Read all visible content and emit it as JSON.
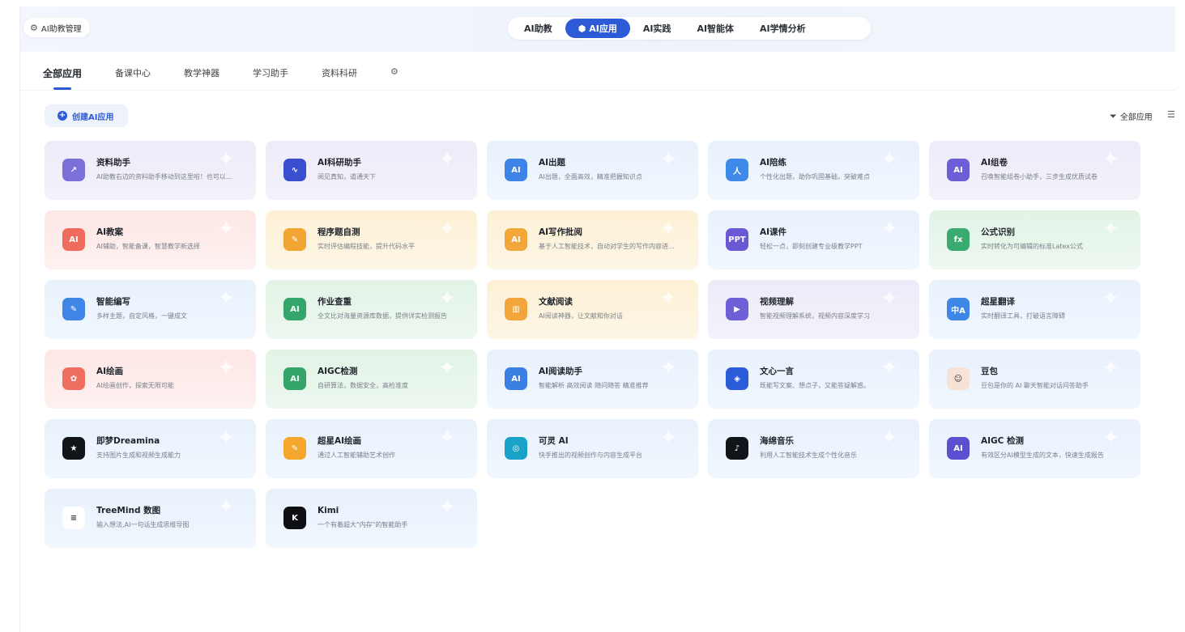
{
  "header": {
    "manage_label": "AI助教管理",
    "nav": [
      {
        "label": "AI助教",
        "active": false
      },
      {
        "label": "AI应用",
        "active": true
      },
      {
        "label": "AI实践",
        "active": false
      },
      {
        "label": "AI智能体",
        "active": false
      },
      {
        "label": "AI学情分析",
        "active": false
      }
    ]
  },
  "subtabs": [
    "全部应用",
    "备课中心",
    "教学神器",
    "学习助手",
    "资料科研"
  ],
  "toolbar": {
    "create_label": "创建AI应用",
    "filter_label": "全部应用"
  },
  "colors": {
    "accent": "#2d5bd7"
  },
  "apps": [
    {
      "title": "资料助手",
      "desc": "AI助教右边的资料助手移动到这里啦！也可以...",
      "theme": "purple",
      "icon": "chart-icon",
      "icon_bg": "#7b6fd8",
      "glyph": "↗"
    },
    {
      "title": "AI科研助手",
      "desc": "阅见真知，道通天下",
      "theme": "purple",
      "icon": "research-icon",
      "icon_bg": "#3a4fd0",
      "glyph": "∿"
    },
    {
      "title": "AI出题",
      "desc": "AI出题，全面高效，精准把握知识点",
      "theme": "blue",
      "icon": "question-icon",
      "icon_bg": "#3e84e6",
      "glyph": "AI"
    },
    {
      "title": "AI陪练",
      "desc": "个性化出题，助你巩固基础，突破难点",
      "theme": "blue",
      "icon": "practice-icon",
      "icon_bg": "#3f8ae8",
      "glyph": "人"
    },
    {
      "title": "AI组卷",
      "desc": "召唤智能组卷小助手，三步生成优质试卷",
      "theme": "purple",
      "icon": "layers-icon",
      "icon_bg": "#6c5ed6",
      "glyph": "AI"
    },
    {
      "title": "AI教案",
      "desc": "AI辅助，智能备课，智慧教学新选择",
      "theme": "pink",
      "icon": "lesson-plan-icon",
      "icon_bg": "#ef6b5d",
      "glyph": "AI"
    },
    {
      "title": "程序题自测",
      "desc": "实时评估编程技能，提升代码水平",
      "theme": "yellow",
      "icon": "code-icon",
      "icon_bg": "#f2a532",
      "glyph": "✎"
    },
    {
      "title": "AI写作批阅",
      "desc": "基于人工智能技术，自动对学生的写作内容进...",
      "theme": "yellow",
      "icon": "writing-review-icon",
      "icon_bg": "#f3a63a",
      "glyph": "AI"
    },
    {
      "title": "AI课件",
      "desc": "轻松一点，即刻创建专业级教学PPT",
      "theme": "blue",
      "icon": "ppt-icon",
      "icon_bg": "#6b58d4",
      "glyph": "PPT"
    },
    {
      "title": "公式识别",
      "desc": "实时转化为可编辑的标准Latex公式",
      "theme": "green",
      "icon": "formula-icon",
      "icon_bg": "#3aaa6e",
      "glyph": "fx"
    },
    {
      "title": "智能编写",
      "desc": "多样主题，自定风格，一键成文",
      "theme": "blue",
      "icon": "edit-icon",
      "icon_bg": "#3f86e6",
      "glyph": "✎"
    },
    {
      "title": "作业查重",
      "desc": "全文比对海量资源库数据，提供详实检测报告",
      "theme": "green",
      "icon": "duplicate-check-icon",
      "icon_bg": "#34a66c",
      "glyph": "AI"
    },
    {
      "title": "文献阅读",
      "desc": "AI阅读神器，让文献和你对话",
      "theme": "yellow",
      "icon": "book-icon",
      "icon_bg": "#f2a53a",
      "glyph": "▥"
    },
    {
      "title": "视频理解",
      "desc": "智能视频理解系统，视频内容深度学习",
      "theme": "purple",
      "icon": "video-icon",
      "icon_bg": "#6d5fd6",
      "glyph": "▶"
    },
    {
      "title": "超星翻译",
      "desc": "实时翻译工具，打破语言障碍",
      "theme": "blue",
      "icon": "translate-icon",
      "icon_bg": "#3d86e6",
      "glyph": "中A"
    },
    {
      "title": "AI绘画",
      "desc": "AI绘画创作，探索无限可能",
      "theme": "pink",
      "icon": "palette-icon",
      "icon_bg": "#ef6e5f",
      "glyph": "✿"
    },
    {
      "title": "AIGC检测",
      "desc": "自研算法，数据安全，高检准度",
      "theme": "green",
      "icon": "aigc-detect-icon",
      "icon_bg": "#34a468",
      "glyph": "AI"
    },
    {
      "title": "AI阅读助手",
      "desc": "智能解析 高效阅读 随问随答 精准推荐",
      "theme": "blue",
      "icon": "reading-icon",
      "icon_bg": "#3b7fe2",
      "glyph": "AI"
    },
    {
      "title": "文心一言",
      "desc": "既能写文案、想点子，又能答疑解惑。",
      "theme": "blue",
      "icon": "wenxin-icon",
      "icon_bg": "#2a5bd8",
      "glyph": "◈"
    },
    {
      "title": "豆包",
      "desc": "豆包是你的 AI 聊天智能对话问答助手",
      "theme": "blue",
      "icon": "doubao-avatar-icon",
      "icon_bg": "#f6e3d6",
      "glyph": "☺"
    },
    {
      "title": "即梦Dreamina",
      "desc": "支持图片生成和视频生成能力",
      "theme": "blue",
      "icon": "dreamina-icon",
      "icon_bg": "#111418",
      "glyph": "★"
    },
    {
      "title": "超星AI绘画",
      "desc": "通过人工智能辅助艺术创作",
      "theme": "blue",
      "icon": "brush-icon",
      "icon_bg": "#f4a72c",
      "glyph": "✎"
    },
    {
      "title": "可灵 AI",
      "desc": "快手推出的视频创作与内容生成平台",
      "theme": "blue",
      "icon": "kling-icon",
      "icon_bg": "#1aa3c9",
      "glyph": "◎"
    },
    {
      "title": "海绵音乐",
      "desc": "利用人工智能技术生成个性化音乐",
      "theme": "blue",
      "icon": "music-icon",
      "icon_bg": "#111418",
      "glyph": "♪"
    },
    {
      "title": "AIGC 检测",
      "desc": "有效区分AI模型生成的文本，快速生成报告",
      "theme": "blue",
      "icon": "aigc-hex-icon",
      "icon_bg": "#5a50d0",
      "glyph": "AI"
    },
    {
      "title": "TreeMind 数图",
      "desc": "输入想法,AI一句话生成思维导图",
      "theme": "blue",
      "icon": "mindmap-icon",
      "icon_bg": "#ffffff",
      "glyph": "≡"
    },
    {
      "title": "Kimi",
      "desc": "一个有着超大\"内存\"的智能助手",
      "theme": "blue",
      "icon": "kimi-icon",
      "icon_bg": "#0e0f12",
      "glyph": "K"
    }
  ]
}
